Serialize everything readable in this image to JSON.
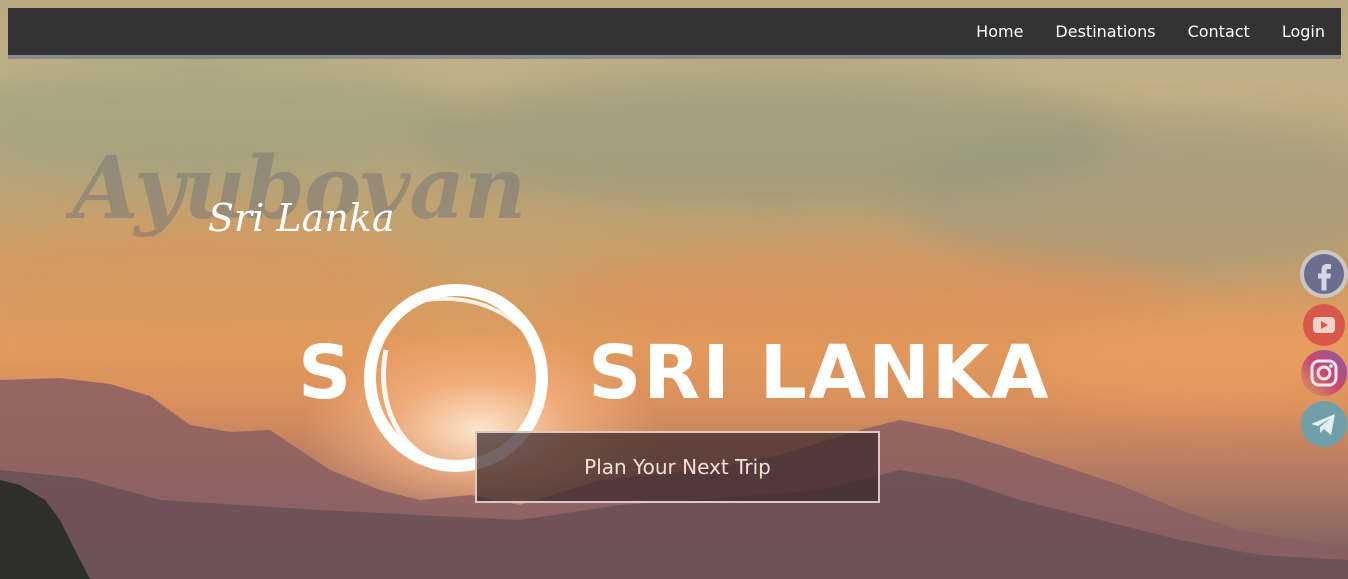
{
  "nav": {
    "links": [
      {
        "label": "Home"
      },
      {
        "label": "Destinations"
      },
      {
        "label": "Contact"
      },
      {
        "label": "Login"
      }
    ]
  },
  "hero": {
    "script_title": "Ayubovan",
    "subtitle": "Sri Lanka",
    "logo_letter": "S",
    "logo_text": "SRI LANKA",
    "cta_label": "Plan Your Next Trip"
  },
  "social": [
    {
      "icon": "facebook-icon",
      "color": "#6b6e8f",
      "glyph": "f"
    },
    {
      "icon": "youtube-icon",
      "color": "#d9584a"
    },
    {
      "icon": "instagram-icon",
      "color": "#c8476f"
    },
    {
      "icon": "telegram-icon",
      "color": "#6f9fa8"
    }
  ],
  "colors": {
    "navbar": "#333333",
    "navbar_border": "#8b8b8b",
    "cta_border": "#d8c9c4"
  }
}
